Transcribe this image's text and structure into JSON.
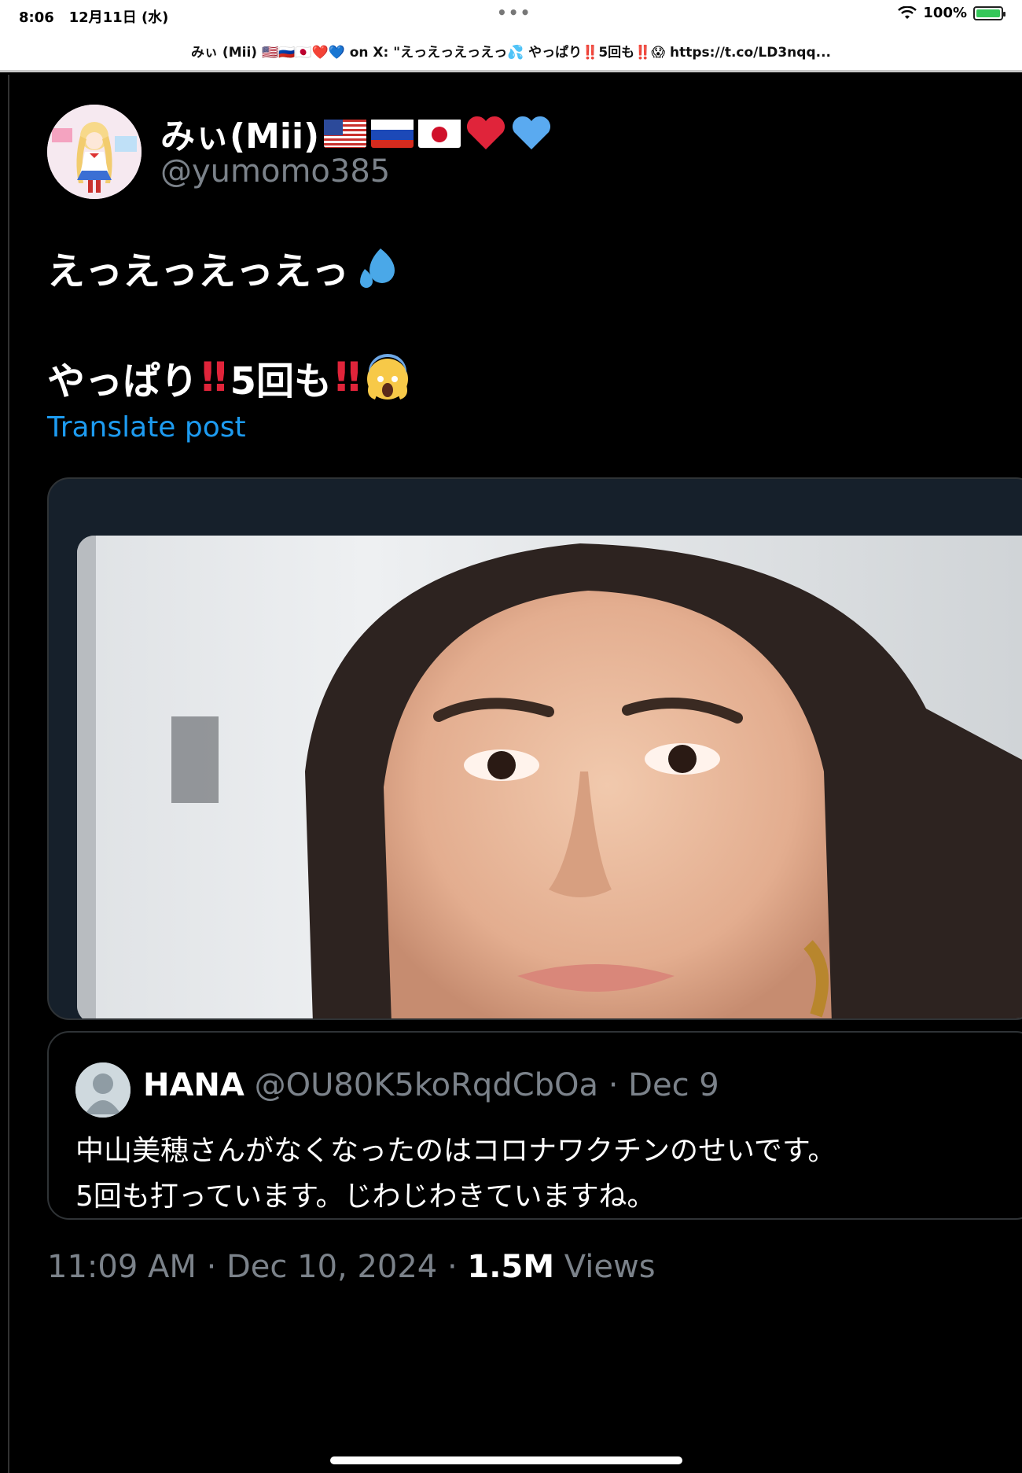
{
  "status_bar": {
    "time": "8:06",
    "date": "12月11日 (水)",
    "dots": "•••",
    "battery": "100%",
    "wifi_icon": "wifi-icon"
  },
  "tab": {
    "title": "みぃ (Mii) 🇺🇸🇷🇺🇯🇵❤️💙 on X: \"えっえっえっえっ💦 やっぱり‼️5回も‼️😱 https://t.co/LD3nqq..."
  },
  "post": {
    "display_name": "みぃ(Mii)",
    "handle": "@yumomo385",
    "line1": "えっえっえっえっ",
    "line1_emoji": "💦",
    "line2_a": "やっぱり",
    "line2_excl": "‼",
    "line2_b": "5回も",
    "line2_excl2": "‼",
    "line2_emoji": "😱",
    "translate_label": "Translate post",
    "heart_red": "❤",
    "heart_blue": "💙"
  },
  "quote": {
    "name": "HANA",
    "handle_date": " @OU80K5koRqdCbOa · Dec 9",
    "text_line1": "中山美穂さんがなくなったのはコロナワクチンのせいです。",
    "text_line2": "5回も打っています。じわじわきていますね。"
  },
  "meta": {
    "time_date": "11:09 AM · Dec 10, 2024 · ",
    "views_count": "1.5M",
    "views_label": " Views"
  },
  "colors": {
    "link": "#1d9bf0",
    "muted": "#7b828a",
    "background": "#000000",
    "card_border": "#2f3336"
  }
}
